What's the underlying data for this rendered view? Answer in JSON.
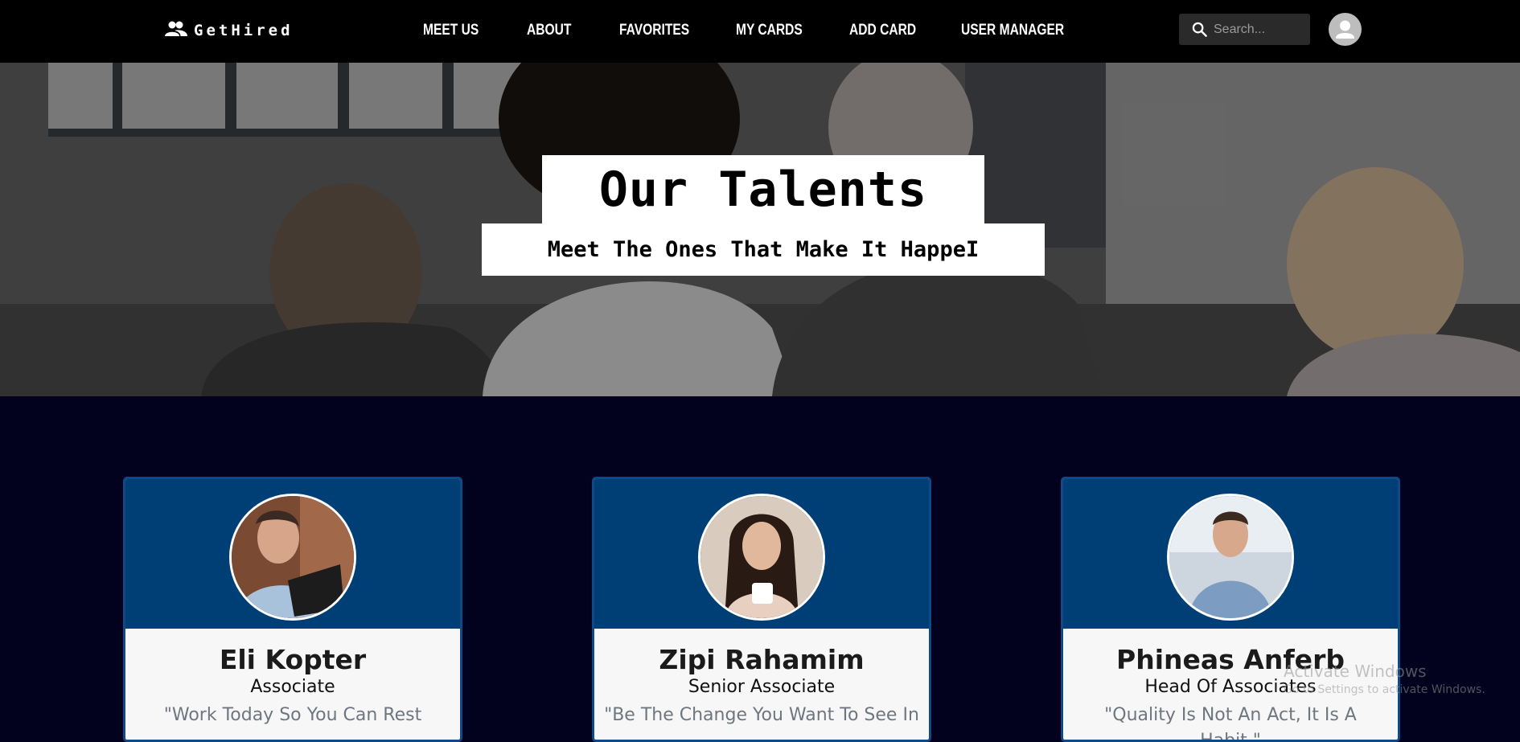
{
  "navbar": {
    "brand": "GetHired",
    "links": [
      "MEET US",
      "ABOUT",
      "FAVORITES",
      "MY CARDS",
      "ADD CARD",
      "USER MANAGER"
    ],
    "search_placeholder": "Search..."
  },
  "hero": {
    "title": "Our Talents",
    "subtitle": "Meet The Ones That Make It HappeI"
  },
  "cards": [
    {
      "name": "Eli Kopter",
      "role": "Associate",
      "quote": "\"Work Today So You Can Rest"
    },
    {
      "name": "Zipi Rahamim",
      "role": "Senior Associate",
      "quote": "\"Be The Change You Want To See In"
    },
    {
      "name": "Phineas Anferb",
      "role": "Head Of Associates",
      "quote": "\"Quality Is Not An Act, It Is A Habit.\""
    }
  ],
  "watermark": {
    "title": "Activate Windows",
    "subtitle": "Go to Settings to activate Windows."
  },
  "colors": {
    "navbar": "#000000",
    "page_background": "#02021f",
    "card_header": "#003e76",
    "card_border": "#0f4a86"
  }
}
